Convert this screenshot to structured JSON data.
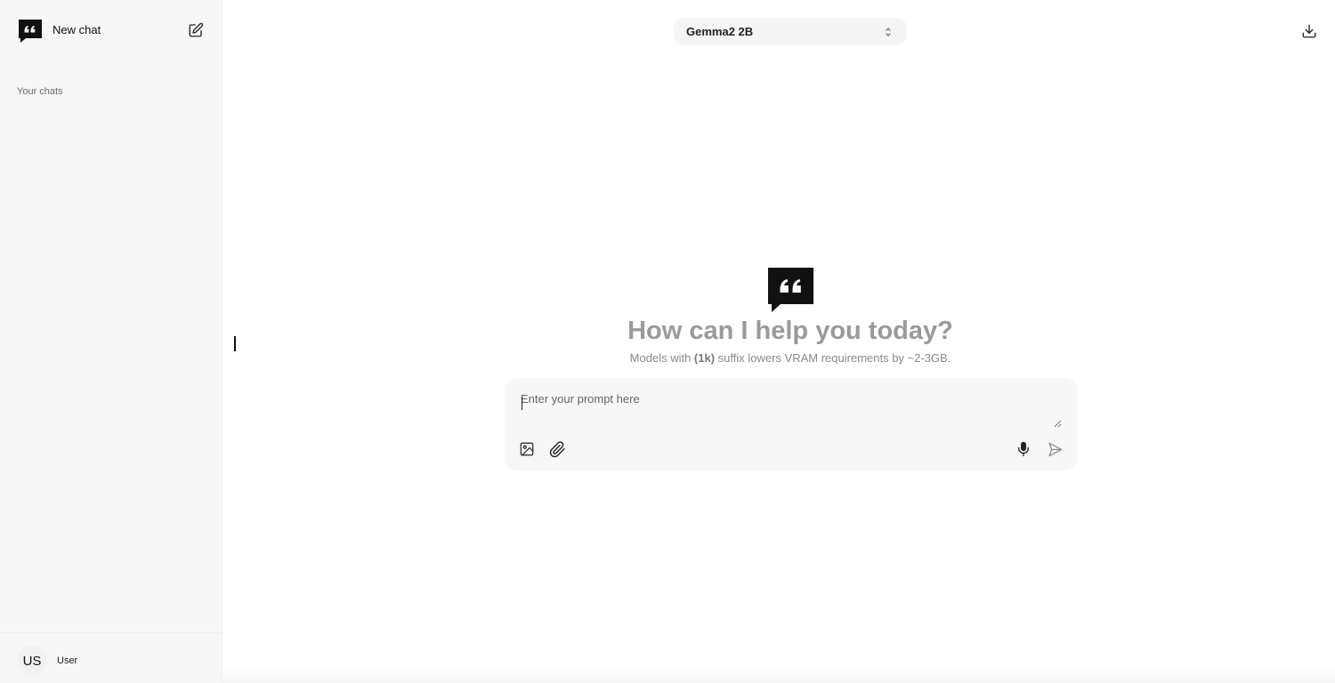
{
  "sidebar": {
    "new_chat_label": "New chat",
    "section_label": "Your chats",
    "user": {
      "initials": "US",
      "name": "User"
    }
  },
  "header": {
    "model_selected": "Gemma2 2B"
  },
  "hero": {
    "title": "How can I help you today?",
    "subtitle_prefix": "Models with ",
    "subtitle_bold": "(1k)",
    "subtitle_suffix": " suffix lowers VRAM requirements by ~2-3GB."
  },
  "prompt": {
    "placeholder": "Enter your prompt here",
    "value": ""
  },
  "icons": {
    "logo": "quote-bubble-icon",
    "new_chat": "edit-square-icon",
    "download": "download-icon",
    "model_select": "chevron-up-down-icon",
    "image_upload": "image-icon",
    "attach": "paperclip-icon",
    "mic": "microphone-icon",
    "send": "send-icon"
  },
  "colors": {
    "sidebar_bg": "#f7f7f7",
    "prompt_bg": "#f7f7f7",
    "hero_title": "#9a9a9a",
    "logo": "#111111"
  }
}
